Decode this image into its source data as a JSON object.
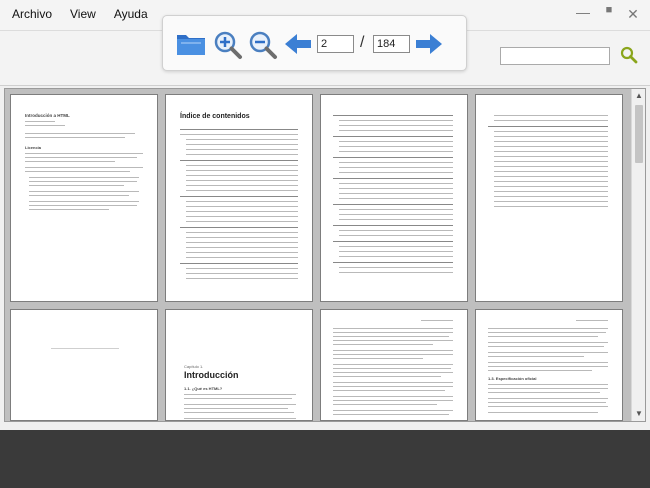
{
  "menu": [
    "Archivo",
    "View",
    "Ayuda"
  ],
  "window_controls": {
    "minimize": "—",
    "maximize": "■",
    "close": "✕"
  },
  "toolbar": {
    "current_page": "2",
    "separator": "/",
    "total_pages": "184"
  },
  "search": {
    "value": ""
  },
  "icons": {
    "open": "folder-icon",
    "zoom_in": "zoom-in-icon",
    "zoom_out": "zoom-out-icon",
    "prev": "arrow-left-icon",
    "next": "arrow-right-icon",
    "search": "search-icon"
  },
  "colors": {
    "accent_blue": "#3b7fd4",
    "search_green": "#8aa51b"
  },
  "pages": {
    "p1": {
      "title": "Introducción a HTML",
      "section": "Licencia"
    },
    "p2": {
      "title": "Índice de contenidos"
    },
    "p6": {
      "label": "Capítulo 1.",
      "title": "Introducción",
      "section": "1.1. ¿Qué es HTML?"
    },
    "p8": {
      "section": "1.3. Especificación oficial"
    }
  }
}
